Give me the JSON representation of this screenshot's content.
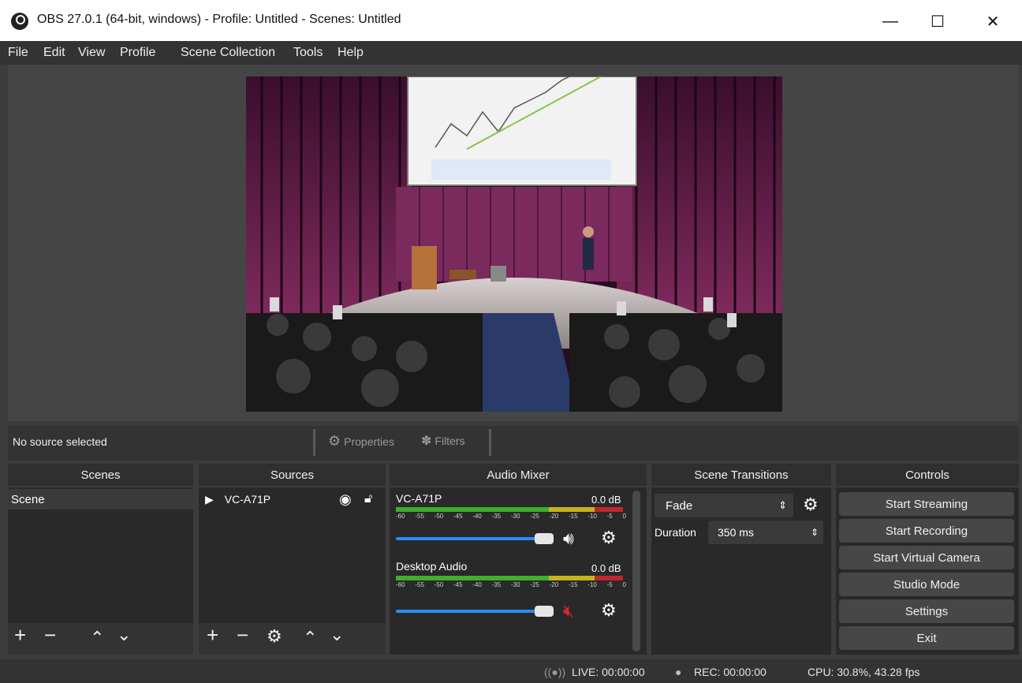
{
  "window": {
    "title": "OBS 27.0.1 (64-bit, windows) - Profile: Untitled - Scenes: Untitled",
    "minimize": "—",
    "maximize": "☐",
    "close": "✕"
  },
  "menu": [
    "File",
    "Edit",
    "View",
    "Profile",
    "Scene Collection",
    "Tools",
    "Help"
  ],
  "source_bar": {
    "no_source": "No source selected",
    "properties": "Properties",
    "filters": "Filters"
  },
  "docks": {
    "scenes": "Scenes",
    "sources": "Sources",
    "audio_mixer": "Audio Mixer",
    "scene_transitions": "Scene Transitions",
    "controls": "Controls"
  },
  "scenes": [
    "Scene"
  ],
  "sources": [
    {
      "name": "VC-A71P"
    }
  ],
  "mixer": [
    {
      "name": "VC-A71P",
      "db": "0.0 dB",
      "muted": false
    },
    {
      "name": "Desktop Audio",
      "db": "0.0 dB",
      "muted": true
    }
  ],
  "meter_ticks": [
    "-60",
    "-55",
    "-50",
    "-45",
    "-40",
    "-35",
    "-30",
    "-25",
    "-20",
    "-15",
    "-10",
    "-5",
    "0"
  ],
  "transitions": {
    "selected": "Fade",
    "duration_label": "Duration",
    "duration_value": "350 ms"
  },
  "controls": [
    "Start Streaming",
    "Start Recording",
    "Start Virtual Camera",
    "Studio Mode",
    "Settings",
    "Exit"
  ],
  "status": {
    "live": "LIVE: 00:00:00",
    "rec": "REC: 00:00:00",
    "cpu": "CPU: 30.8%, 43.28 fps"
  },
  "colors": {
    "accent_slider": "#2d8cff",
    "mute_red": "#e02424",
    "meter_green": "#3fae2a",
    "meter_yellow": "#c8b21f",
    "meter_red": "#c2272d"
  }
}
